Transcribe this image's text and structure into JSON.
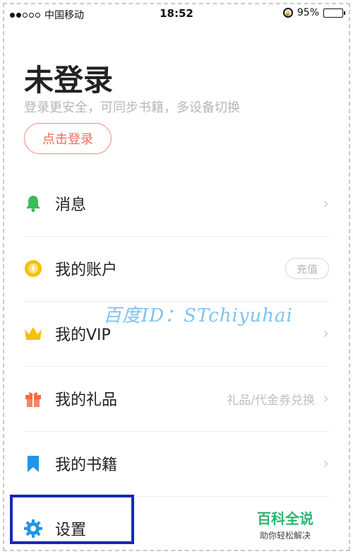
{
  "status_bar": {
    "signal_dots": 5,
    "signal_strength": 2,
    "carrier": "中国移动",
    "time": "18:52",
    "battery": "95%"
  },
  "header": {
    "title": "未登录",
    "subtitle": "登录更安全，可同步书籍，多设备切换",
    "login_button": "点击登录"
  },
  "menu": {
    "items": [
      {
        "label": "消息",
        "icon": "bell-icon",
        "color": "#3dbb5a"
      },
      {
        "label": "我的账户",
        "icon": "coin-icon",
        "color": "#f4c10a",
        "action": "充值"
      },
      {
        "label": "我的VIP",
        "icon": "crown-icon",
        "color": "#f4c10a"
      },
      {
        "label": "我的礼品",
        "icon": "gift-icon",
        "color": "#f26a4a",
        "hint": "礼品/代金券兑换"
      },
      {
        "label": "我的书籍",
        "icon": "bookmark-icon",
        "color": "#2196e6"
      },
      {
        "label": "设置",
        "icon": "gear-icon",
        "color": "#2196e6"
      }
    ]
  },
  "watermark": "百度ID：STchiyuhai",
  "brand": {
    "name": "百科全说",
    "slogan": "助你轻松解决"
  },
  "colors": {
    "accent": "#ee6f58",
    "highlight": "#1828b8",
    "brand_green": "#2bb672"
  }
}
